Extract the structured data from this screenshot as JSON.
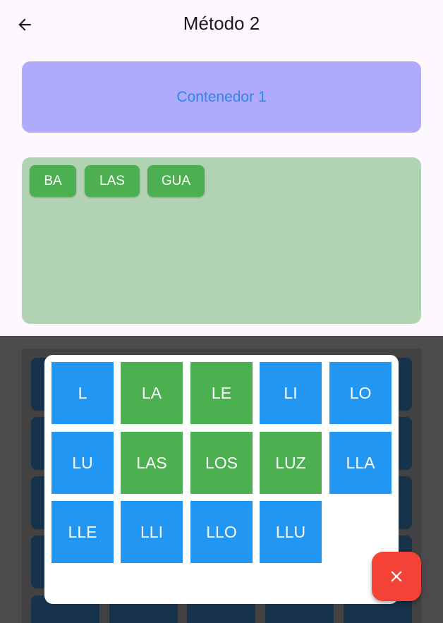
{
  "appbar": {
    "title": "Método 2",
    "back_icon": "arrow-left-icon"
  },
  "container1": {
    "label": "Contenedor 1",
    "bg": "#b0aafd",
    "text_color": "#2f86e8"
  },
  "container2": {
    "bg": "#b2d3b3",
    "chips": [
      {
        "label": "BA"
      },
      {
        "label": "LAS"
      },
      {
        "label": "GUA"
      }
    ]
  },
  "dialog": {
    "tiles": [
      {
        "label": "L",
        "color": "blue"
      },
      {
        "label": "LA",
        "color": "green"
      },
      {
        "label": "LE",
        "color": "green"
      },
      {
        "label": "LI",
        "color": "blue"
      },
      {
        "label": "LO",
        "color": "blue"
      },
      {
        "label": "LU",
        "color": "blue"
      },
      {
        "label": "LAS",
        "color": "green"
      },
      {
        "label": "LOS",
        "color": "green"
      },
      {
        "label": "LUZ",
        "color": "green"
      },
      {
        "label": "LLA",
        "color": "blue"
      },
      {
        "label": "LLE",
        "color": "blue"
      },
      {
        "label": "LLI",
        "color": "blue"
      },
      {
        "label": "LLO",
        "color": "blue"
      },
      {
        "label": "LLU",
        "color": "blue"
      }
    ]
  },
  "fab": {
    "icon": "close-icon",
    "color": "#f44336"
  },
  "colors": {
    "blue": "#2196f3",
    "green": "#4caf50",
    "scrim": "#4c4a4c"
  }
}
